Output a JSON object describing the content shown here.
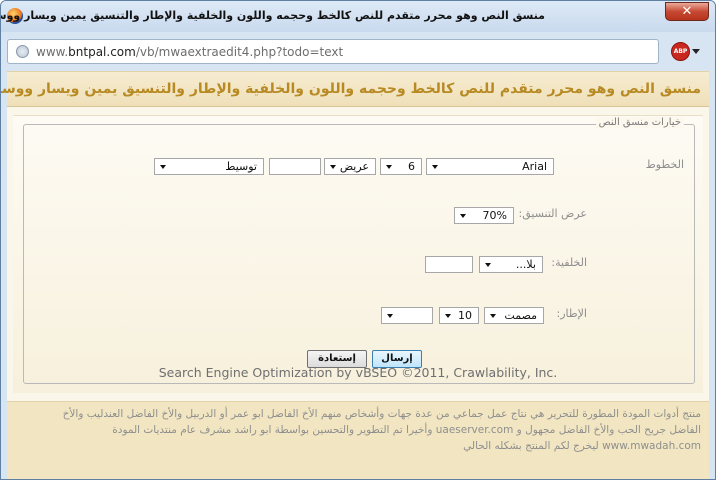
{
  "window": {
    "title": "Mozilla Firefox - !! منسق النص وهو محرر متقدم للنص كالخط وحجمه واللون والخلفية والإطار والتنسيق يمين ويسار ووسط وتعبئة",
    "close_label": "✕"
  },
  "addressbar": {
    "url_prefix": "www.",
    "url_domain": "bntpal.com",
    "url_path": "/vb/mwaextraedit4.php?todo=text",
    "abp_label": "ABP"
  },
  "banner": {
    "text": "منسق النص وهو محرر متقدم للنص كالخط وحجمه واللون والخلفية والإطار والتنسيق يمين ويسار ووسط وتعبئة !!"
  },
  "form": {
    "legend": "خيارات منسق النص",
    "font_label": "الخطوط",
    "font_value": "Arial",
    "size_value": "6",
    "weight_value": "عريض",
    "style_value": "",
    "align_value": "توسيط",
    "width_label": "عرض التنسيق:",
    "width_value": "70%",
    "background_label": "الخلفية:",
    "background_value": "بلا...",
    "background_extra": "",
    "border_label": "الإطار:",
    "border_style": "مصمت",
    "border_size": "10",
    "border_color": "",
    "submit_label": "إرسال",
    "reset_label": "إستعادة"
  },
  "seo_line": "Search Engine Optimization by vBSEO ©2011, Crawlability, Inc.",
  "footer": {
    "line1": "منتج أدوات المودة المطورة للتحرير هي نتاج عمل جماعي من عدة جهات وأشخاص منهم الأخ الفاضل ابو عمر أو الدربيل والأخ الفاضل العندليب والأخ",
    "line2": "الفاضل جريح الحب والأخ الفاضل مجهول و uaeserver.com وأخيرا تم التطوير والتحسين بواسطة ابو راشد مشرف عام منتديات المودة",
    "line3": "www.mwadah.com ليخرج لكم المنتج بشكله الحالي"
  },
  "colors": {
    "banner_text": "#b78a24",
    "window_frame": "#d7e4f2",
    "close_button": "#c74a33"
  }
}
